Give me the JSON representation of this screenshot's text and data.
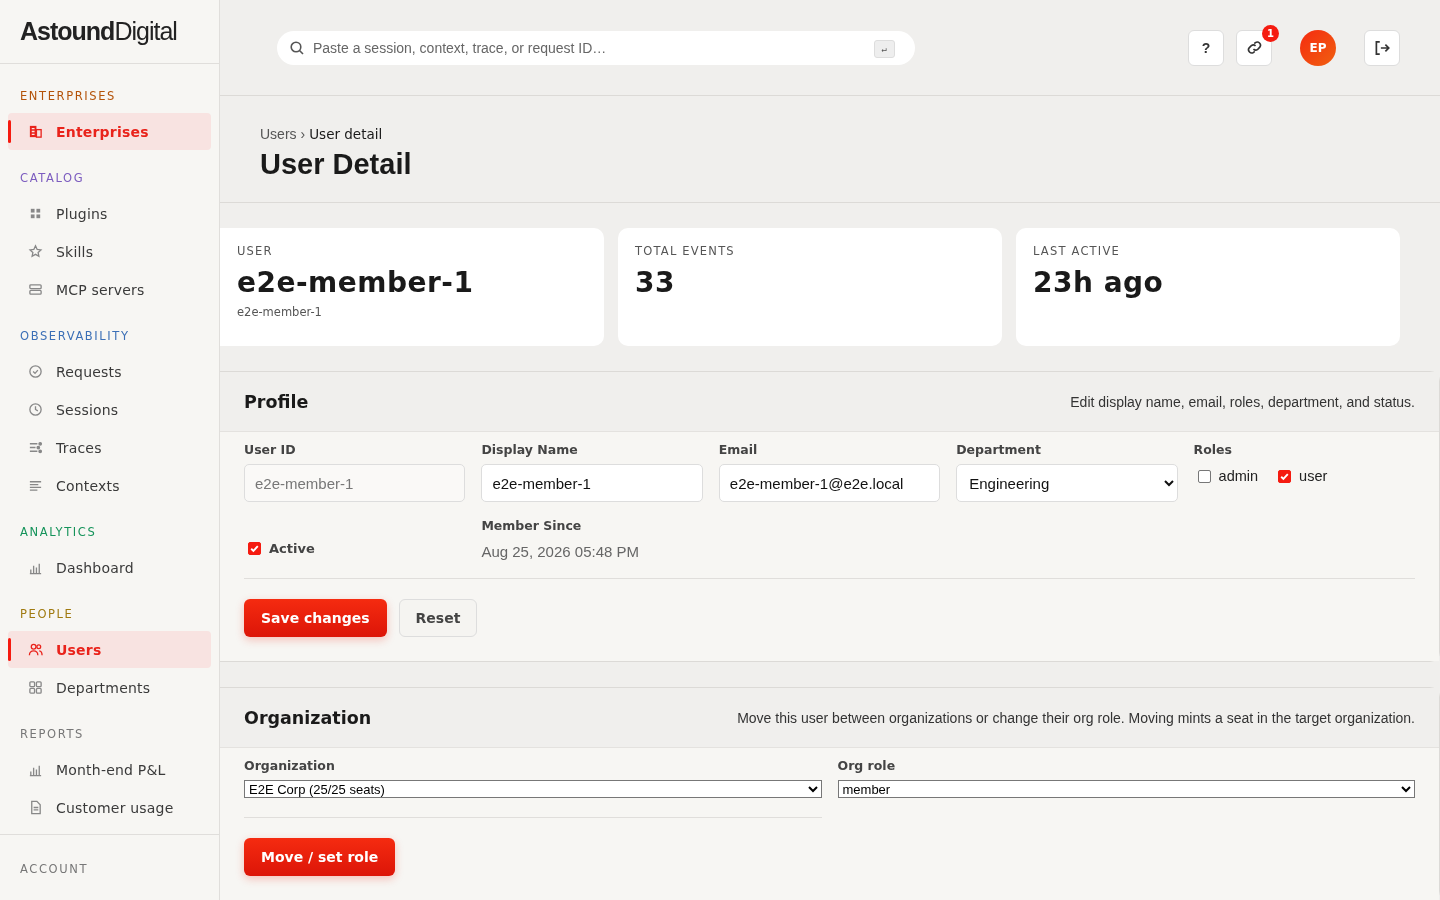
{
  "sidebar": {
    "logo": "**Astound**Digital",
    "sections": [
      {
        "title": "ENTERPRISES",
        "color": "#b45309",
        "items": [
          {
            "label": "Enterprises",
            "kind": "building",
            "selected": true
          }
        ]
      },
      {
        "title": "CATALOG",
        "color": "#7c5cbf",
        "items": [
          {
            "label": "Plugins",
            "kind": "grid",
            "selected": false
          },
          {
            "label": "Skills",
            "kind": "star",
            "selected": false
          },
          {
            "label": "MCP servers",
            "kind": "server",
            "selected": false
          }
        ]
      },
      {
        "title": "OBSERVABILITY",
        "color": "#3b6fb6",
        "items": [
          {
            "label": "Requests",
            "kind": "check",
            "selected": false
          },
          {
            "label": "Sessions",
            "kind": "clock",
            "selected": false
          },
          {
            "label": "Traces",
            "kind": "traces",
            "selected": false
          },
          {
            "label": "Contexts",
            "kind": "lines",
            "selected": false
          }
        ]
      },
      {
        "title": "ANALYTICS",
        "color": "#15935a",
        "items": [
          {
            "label": "Dashboard",
            "kind": "bars",
            "selected": false
          }
        ]
      },
      {
        "title": "PEOPLE",
        "color": "#a07a10",
        "items": [
          {
            "label": "Users",
            "kind": "users",
            "selected": true
          },
          {
            "label": "Departments",
            "kind": "squares",
            "selected": false
          }
        ]
      },
      {
        "title": "REPORTS",
        "color": "#777777",
        "items": [
          {
            "label": "Month-end P&L",
            "kind": "bars",
            "selected": false
          },
          {
            "label": "Customer usage",
            "kind": "doc",
            "selected": false
          }
        ]
      },
      {
        "title": "ACCOUNT",
        "color": "#777777"
      }
    ]
  },
  "topbar": {
    "search": {
      "placeholder": "Paste a session, context, trace, or request ID…",
      "key": "↵"
    },
    "help": "?",
    "link_badge": "1",
    "avatar": "EP"
  },
  "breadcrumb": {
    "parent": "Users",
    "separator": "›",
    "current": "User detail"
  },
  "title": "User Detail",
  "stats": [
    {
      "label": "USER",
      "value": "e2e-member-1",
      "sub": "e2e-member-1"
    },
    {
      "label": "TOTAL EVENTS",
      "value": "33"
    },
    {
      "label": "LAST ACTIVE",
      "value": "23h ago"
    }
  ],
  "profile": {
    "title": "Profile",
    "description": "Edit display name, email, roles, department, and status.",
    "user_id": {
      "label": "User ID",
      "value": "e2e-member-1",
      "disabled": true
    },
    "display_name": {
      "label": "Display Name",
      "value": "e2e-member-1"
    },
    "email": {
      "label": "Email",
      "value": "e2e-member-1@e2e.local"
    },
    "department": {
      "label": "Department",
      "value": "Engineering"
    },
    "roles": {
      "label": "Roles",
      "options": [
        {
          "label": "admin",
          "checked": false
        },
        {
          "label": "user",
          "checked": true
        }
      ]
    },
    "active": {
      "label": "Active",
      "checked": true
    },
    "member_since": {
      "label": "Member Since",
      "value": "Aug 25, 2026 05:48 PM"
    },
    "buttons": {
      "save": "Save changes",
      "reset": "Reset"
    }
  },
  "organization": {
    "title": "Organization",
    "description": "Move this user between organizations or change their org role. Moving mints a seat in the target organization.",
    "organization": {
      "label": "Organization",
      "value": "E2E Corp (25/25 seats)"
    },
    "org_role": {
      "label": "Org role",
      "value": "member"
    },
    "button": "Move / set role"
  }
}
